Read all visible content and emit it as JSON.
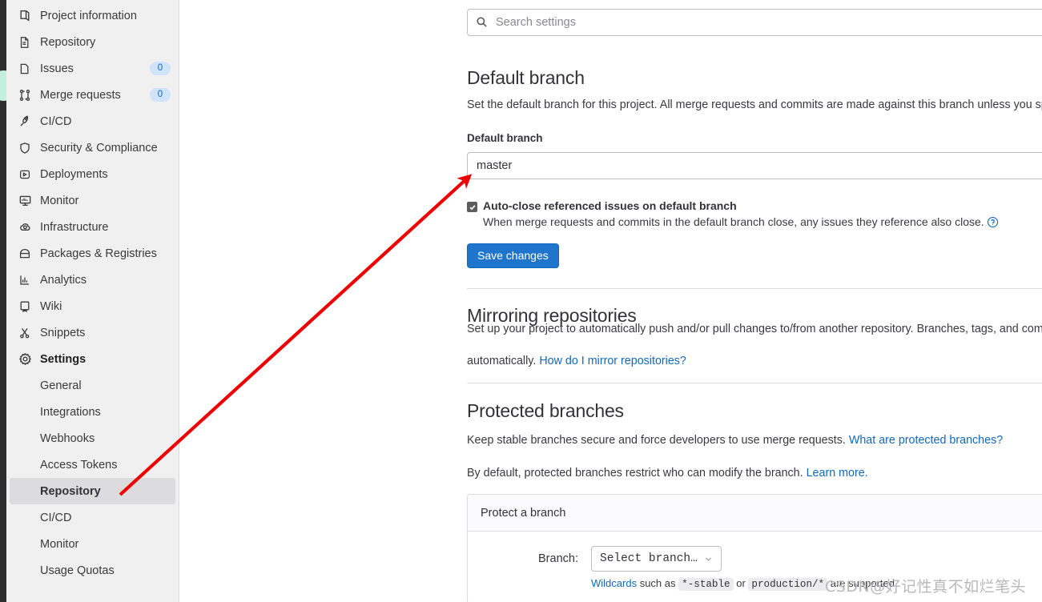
{
  "colors": {
    "accent": "#1f75cb",
    "link": "#1068bf",
    "sidebar_bg": "#f0f0f0",
    "selected_bg": "#dcdcdf",
    "badge_bg": "#cfe3fb",
    "badge_fg": "#1068bf",
    "annotation": "#ee0000"
  },
  "sidebar": {
    "items": [
      {
        "label": "Project information",
        "icon": "project-information-icon",
        "badge": null
      },
      {
        "label": "Repository",
        "icon": "repository-icon",
        "badge": null
      },
      {
        "label": "Issues",
        "icon": "issues-icon",
        "badge": "0"
      },
      {
        "label": "Merge requests",
        "icon": "merge-requests-icon",
        "badge": "0"
      },
      {
        "label": "CI/CD",
        "icon": "rocket-icon",
        "badge": null
      },
      {
        "label": "Security & Compliance",
        "icon": "shield-icon",
        "badge": null
      },
      {
        "label": "Deployments",
        "icon": "deployments-icon",
        "badge": null
      },
      {
        "label": "Monitor",
        "icon": "monitor-icon",
        "badge": null
      },
      {
        "label": "Infrastructure",
        "icon": "cloud-gear-icon",
        "badge": null
      },
      {
        "label": "Packages & Registries",
        "icon": "package-icon",
        "badge": null
      },
      {
        "label": "Analytics",
        "icon": "analytics-icon",
        "badge": null
      },
      {
        "label": "Wiki",
        "icon": "book-icon",
        "badge": null
      },
      {
        "label": "Snippets",
        "icon": "scissors-icon",
        "badge": null
      },
      {
        "label": "Settings",
        "icon": "gear-icon",
        "badge": null
      }
    ],
    "settings_sub_items": [
      {
        "label": "General",
        "selected": false
      },
      {
        "label": "Integrations",
        "selected": false
      },
      {
        "label": "Webhooks",
        "selected": false
      },
      {
        "label": "Access Tokens",
        "selected": false
      },
      {
        "label": "Repository",
        "selected": true
      },
      {
        "label": "CI/CD",
        "selected": false
      },
      {
        "label": "Monitor",
        "selected": false
      },
      {
        "label": "Usage Quotas",
        "selected": false
      }
    ]
  },
  "search": {
    "placeholder": "Search settings",
    "value": ""
  },
  "default_branch": {
    "heading": "Default branch",
    "description": "Set the default branch for this project. All merge requests and commits are made against this branch unless you spec",
    "field_label": "Default branch",
    "field_value": "master",
    "checkbox_label": "Auto-close referenced issues on default branch",
    "checkbox_checked": true,
    "checkbox_help": "When merge requests and commits in the default branch close, any issues they reference also close.",
    "save_label": "Save changes"
  },
  "mirroring": {
    "heading": "Mirroring repositories",
    "description_part1": "Set up your project to automatically push and/or pull changes to/from another repository. Branches, tags, and comm",
    "description_part2": "automatically.",
    "link_label": "How do I mirror repositories?"
  },
  "protected_branches": {
    "heading": "Protected branches",
    "description": "Keep stable branches secure and force developers to use merge requests.",
    "link_label": "What are protected branches?",
    "description2": "By default, protected branches restrict who can modify the branch.",
    "link2_label": "Learn more.",
    "card_title": "Protect a branch",
    "branch_row_label": "Branch:",
    "branch_select_value": "Select branch…",
    "hint_link": "Wildcards",
    "hint_text_1": "such as",
    "hint_code_1": "*-stable",
    "hint_text_2": "or",
    "hint_code_2": "production/*",
    "hint_text_3": "are supported."
  },
  "watermark": {
    "text": "CSDN@好记性真不如烂笔头"
  }
}
